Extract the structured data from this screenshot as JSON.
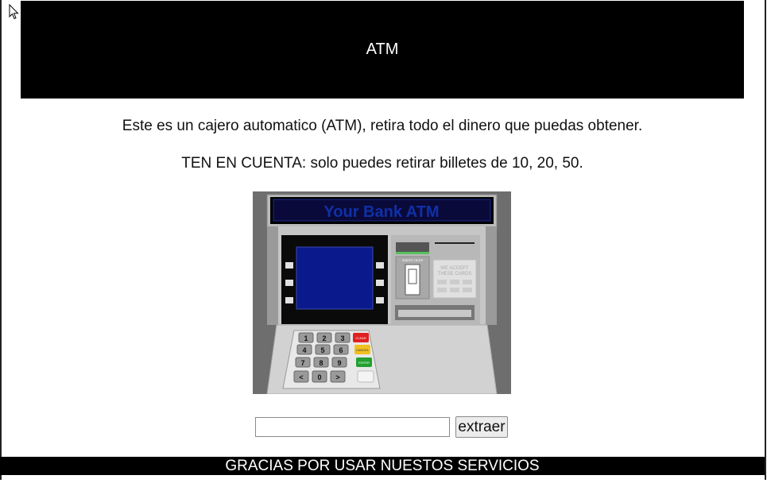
{
  "header": {
    "title": "ATM"
  },
  "content": {
    "intro": "Este es un cajero automatico (ATM), retira todo el dinero que puedas obtener.",
    "note": "TEN EN CUENTA: solo puedes retirar billetes de 10, 20, 50."
  },
  "atm_image": {
    "banner": "Your Bank ATM",
    "insert_label": "INSERT HERE",
    "accept_label_1": "WE ACCEPT",
    "accept_label_2": "THESE CARDS",
    "keys": [
      "1",
      "2",
      "3",
      "4",
      "5",
      "6",
      "7",
      "8",
      "9",
      "<",
      "0",
      ">"
    ],
    "clear": "CLEAR",
    "cancel": "CANCEL",
    "enter": "ENTER"
  },
  "form": {
    "amount_value": "",
    "button_label": "extraer"
  },
  "footer": {
    "text": "GRACIAS POR USAR NUESTOS SERVICIOS"
  },
  "colors": {
    "header_bg": "#000000",
    "screen_blue": "#0a1a8c",
    "banner_text": "#1030a8",
    "atm_body": "#c4c4c4"
  }
}
